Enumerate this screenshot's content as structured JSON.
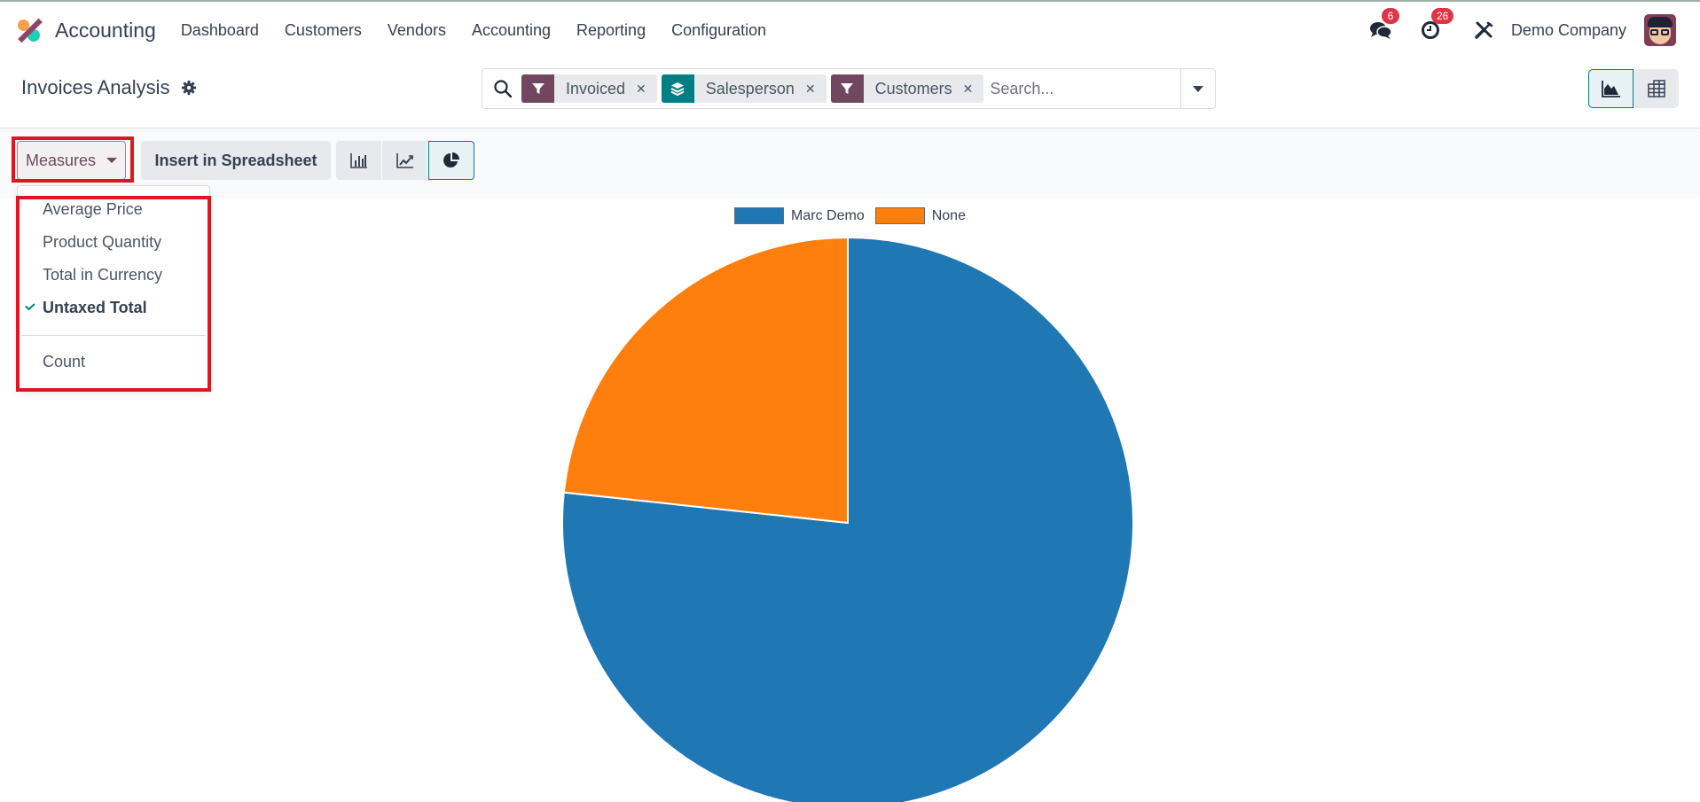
{
  "navbar": {
    "app_name": "Accounting",
    "menu": [
      "Dashboard",
      "Customers",
      "Vendors",
      "Accounting",
      "Reporting",
      "Configuration"
    ],
    "messages_badge": "6",
    "activities_badge": "26",
    "company": "Demo Company"
  },
  "control_panel": {
    "title": "Invoices Analysis",
    "search": {
      "facets": [
        {
          "type": "filter",
          "label": "Invoiced",
          "color": "#71475f"
        },
        {
          "type": "groupby",
          "label": "Salesperson",
          "color": "#017e84"
        },
        {
          "type": "filter",
          "label": "Customers",
          "color": "#71475f"
        }
      ],
      "placeholder": "Search..."
    },
    "views": [
      {
        "name": "graph",
        "active": true
      },
      {
        "name": "pivot",
        "active": false
      }
    ]
  },
  "toolbar": {
    "measures_label": "Measures",
    "insert_label": "Insert in Spreadsheet",
    "chart_modes": [
      {
        "name": "bar",
        "active": false
      },
      {
        "name": "line",
        "active": false
      },
      {
        "name": "pie",
        "active": true
      }
    ]
  },
  "measures_dropdown": {
    "items": [
      {
        "label": "Average Price",
        "selected": false
      },
      {
        "label": "Product Quantity",
        "selected": false
      },
      {
        "label": "Total in Currency",
        "selected": false
      },
      {
        "label": "Untaxed Total",
        "selected": true
      }
    ],
    "count_label": "Count"
  },
  "colors": {
    "accent": "#017e84",
    "brand": "#71475f",
    "highlight": "#e0161f"
  },
  "chart_data": {
    "type": "pie",
    "title": "",
    "measure": "Untaxed Total",
    "categories": [
      "Marc Demo",
      "None"
    ],
    "values": [
      76.7,
      23.3
    ],
    "unit": "percent of total (estimated)",
    "colors": [
      "#1f77b4",
      "#ff7f0e"
    ],
    "legend": "top-center"
  }
}
